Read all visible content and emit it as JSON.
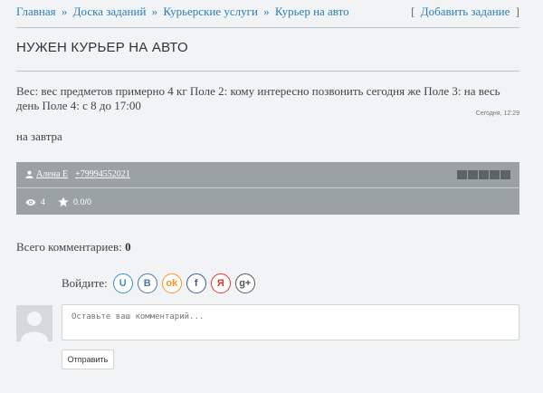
{
  "breadcrumb": {
    "items": [
      "Главная",
      "Доска заданий",
      "Курьерские услуги",
      "Курьер на авто"
    ],
    "separator": "»",
    "add_task_open": "[",
    "add_task_label": "Добавить задание",
    "add_task_close": "]"
  },
  "task": {
    "title": "НУЖЕН КУРЬЕР НА АВТО",
    "description": "Вес: вес предметов примерно 4 кг Поле 2: кому интересно позвонить сегодня же Поле 3: на весь день Поле 4: с 8 до 17:00",
    "posted_time": "Сегодня, 12:29",
    "when": "на завтра"
  },
  "info_bar": {
    "author": "Алена Е",
    "phone": "+79994552021",
    "rating_slots": 5,
    "views": "4",
    "score": "0.0/0"
  },
  "comments": {
    "count_label": "Всего комментариев:",
    "count": "0",
    "login_label": "Войдите:",
    "socials": [
      {
        "icon": "ucoz-icon",
        "glyph": "U",
        "color": "#3a8fd6"
      },
      {
        "icon": "vk-icon",
        "glyph": "B",
        "color": "#4a76a8"
      },
      {
        "icon": "odnoklassniki-icon",
        "glyph": "ok",
        "color": "#f7931e"
      },
      {
        "icon": "facebook-icon",
        "glyph": "f",
        "color": "#3b5998"
      },
      {
        "icon": "yandex-icon",
        "glyph": "Я",
        "color": "#e0332f"
      },
      {
        "icon": "google-plus-icon",
        "glyph": "g+",
        "color": "#555555"
      }
    ],
    "placeholder": "Оставьте ваш комментарий...",
    "submit_label": "Отправить"
  }
}
